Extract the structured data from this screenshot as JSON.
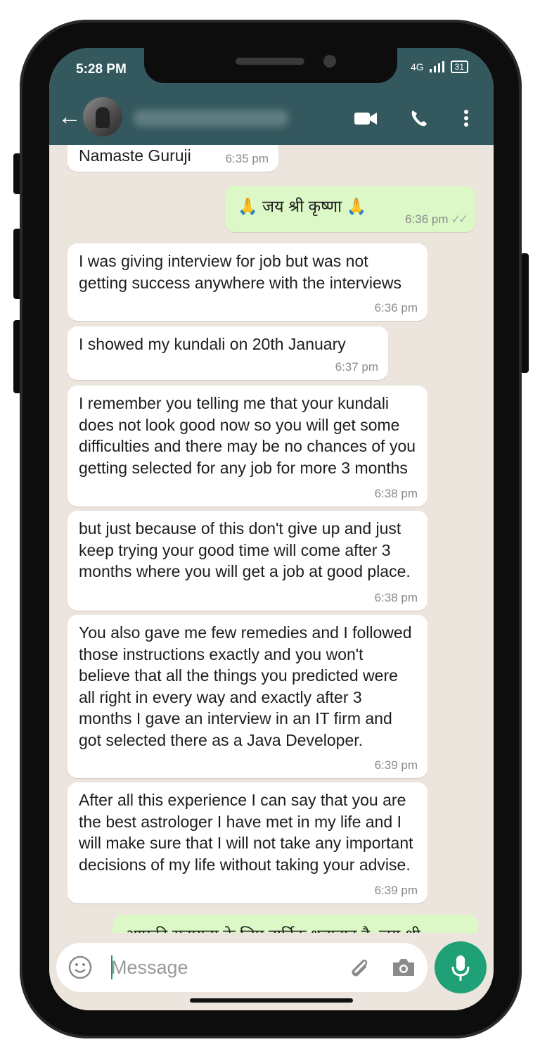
{
  "status_bar": {
    "time": "5:28 PM",
    "network": "4G",
    "battery": "31"
  },
  "header": {
    "back_icon": "arrow-left-icon",
    "video_icon": "video-camera-icon",
    "call_icon": "phone-icon",
    "menu_icon": "more-vertical-icon"
  },
  "messages": [
    {
      "dir": "in",
      "text": "Namaste Guruji",
      "time": "6:35 pm"
    },
    {
      "dir": "out",
      "text": "🙏 जय श्री कृष्णा 🙏",
      "time": "6:36 pm"
    },
    {
      "dir": "in",
      "text": "I was giving interview for job but was not getting success anywhere with the interviews",
      "time": "6:36 pm"
    },
    {
      "dir": "in",
      "text": "I showed my kundali on 20th January",
      "time": "6:37 pm"
    },
    {
      "dir": "in",
      "text": "I remember you telling me that your kundali does not look good now so you will get some difficulties and there may be no chances of you getting selected for any job for more 3 months",
      "time": "6:38 pm"
    },
    {
      "dir": "in",
      "text": "but just because of this don't give up and just keep trying your good time will come after 3 months where you will get a job at good place.",
      "time": "6:38 pm"
    },
    {
      "dir": "in",
      "text": "You also gave me few remedies and I followed those instructions exactly and you won't believe that all the things you predicted were all right in every way and exactly after 3 months I gave an interview in an IT firm and got selected there as a Java Developer.",
      "time": "6:39 pm"
    },
    {
      "dir": "in",
      "text": "After all this experience I can say that you are the best astrologer I have met in my life and I will make sure that I will not take any important decisions of my life without taking your advise.",
      "time": "6:39 pm"
    },
    {
      "dir": "out",
      "text": "आपकी सहायता के लिए हार्दिक धन्यवाद है, जय श्री",
      "time": ""
    }
  ],
  "composer": {
    "placeholder": "Message",
    "emoji_icon": "emoji-icon",
    "attach_icon": "paperclip-icon",
    "camera_icon": "camera-icon",
    "mic_icon": "microphone-icon"
  },
  "colors": {
    "header": "#33585e",
    "incoming": "#ffffff",
    "outgoing": "#dcf8c6",
    "chat_bg": "#ece5dd",
    "mic": "#1fa077"
  }
}
